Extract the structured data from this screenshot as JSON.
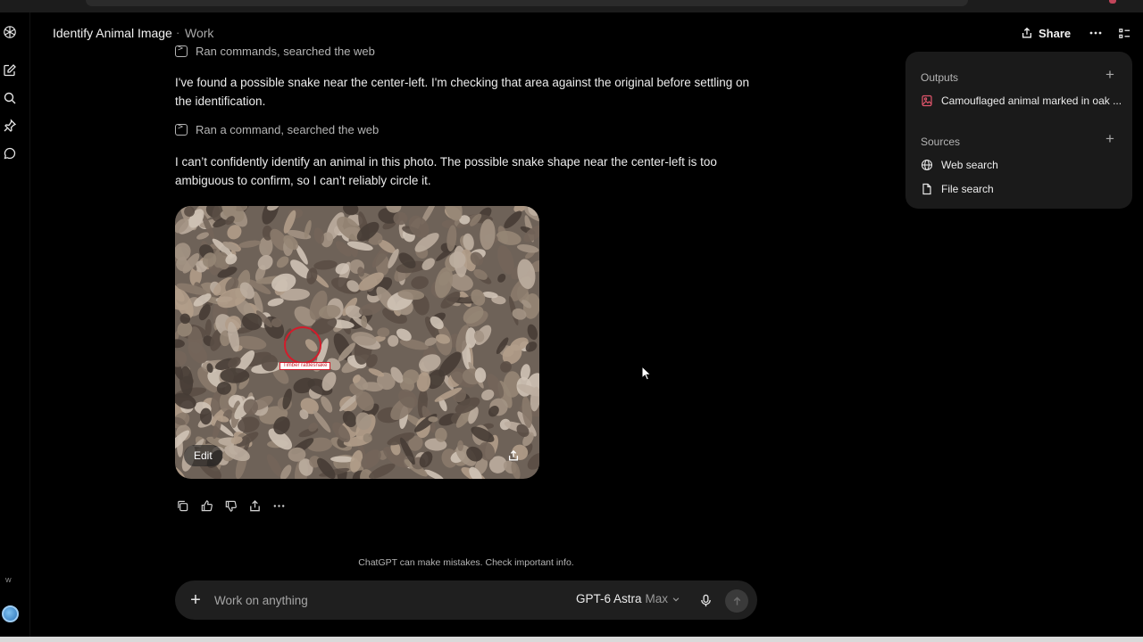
{
  "header": {
    "title": "Identify Animal Image",
    "separator": "·",
    "breadcrumb": "Work",
    "share_label": "Share"
  },
  "messages": {
    "tool_line_1": "Ran commands, searched the web",
    "paragraph_1": "I've found a possible snake near the center-left. I'm checking that area against the original before settling on the identification.",
    "tool_line_2": "Ran a command, searched the web",
    "paragraph_2": "I can’t confidently identify an animal in this photo. The possible snake shape near the center-left is too ambiguous to confirm, so I can’t reliably circle it."
  },
  "image": {
    "annotation_label": "Timber rattlesnake",
    "edit_label": "Edit"
  },
  "disclaimer": "ChatGPT can make mistakes. Check important info.",
  "composer": {
    "placeholder": "Work on anything",
    "model_name": "GPT-6 Astra",
    "model_variant": "Max"
  },
  "panel": {
    "outputs_title": "Outputs",
    "outputs": [
      "Camouflaged animal marked in oak ..."
    ],
    "sources_title": "Sources",
    "sources": [
      "Web search",
      "File search"
    ]
  },
  "sidebar": {
    "workspace_initial": "W"
  },
  "colors": {
    "background": "#000000",
    "panel": "#1a1a1a",
    "composer": "#1f1f1f",
    "annotation_red": "#d31c2b"
  },
  "icons": [
    "openai-logo-icon",
    "new-chat-icon",
    "search-icon",
    "pin-icon",
    "chat-bubble-icon",
    "share-icon",
    "more-icon",
    "sidebar-toggle-icon",
    "terminal-icon",
    "copy-icon",
    "thumbs-up-icon",
    "thumbs-down-icon",
    "microphone-icon",
    "send-icon",
    "plus-icon",
    "globe-icon",
    "file-icon",
    "image-file-icon"
  ]
}
